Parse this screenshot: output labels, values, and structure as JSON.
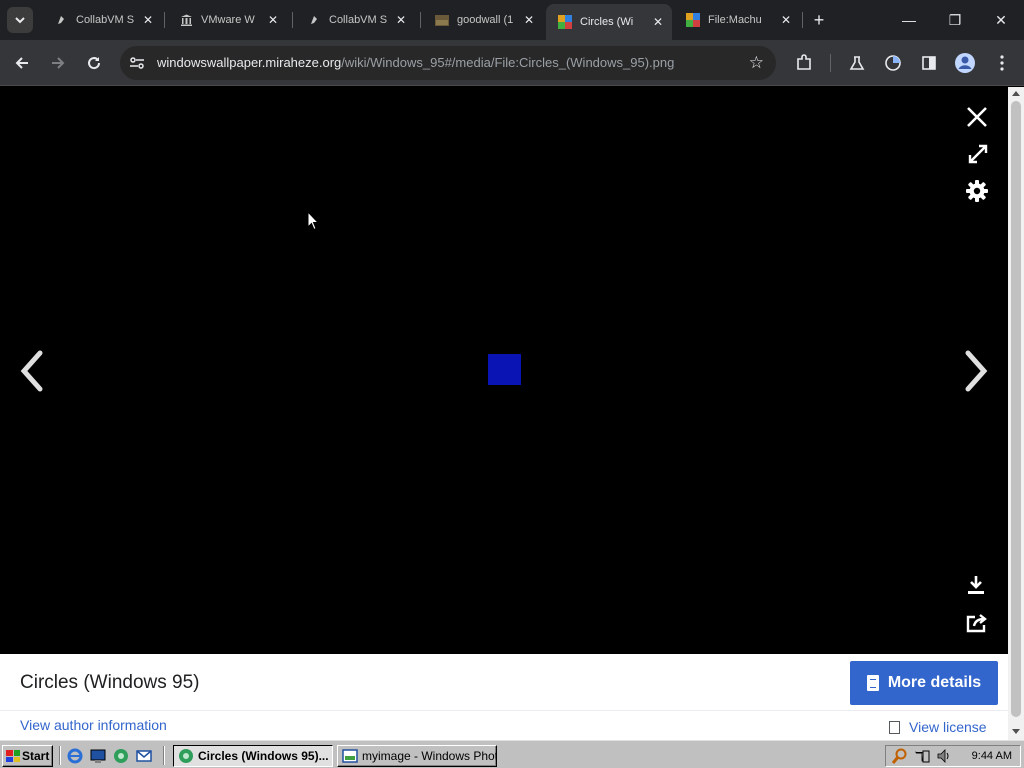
{
  "browser": {
    "tab_search_icon": "chevron-down-icon",
    "tabs": [
      {
        "title": "CollabVM S",
        "favicon": "collabvm-icon",
        "active": false
      },
      {
        "title": "VMware W",
        "favicon": "museum-icon",
        "active": false
      },
      {
        "title": "CollabVM S",
        "favicon": "collabvm-icon",
        "active": false
      },
      {
        "title": "goodwall (1",
        "favicon": "image-icon",
        "active": false
      },
      {
        "title": "Circles (Wi",
        "favicon": "wallpaper-icon",
        "active": true
      },
      {
        "title": "File:Machu",
        "favicon": "wallpaper-icon",
        "active": false
      }
    ],
    "new_tab_glyph": "+",
    "window_controls": {
      "minimize": "—",
      "restore": "❐",
      "close": "✕"
    },
    "url_host": "windowswallpaper.miraheze.org",
    "url_path": "/wiki/Windows_95#/media/File:Circles_(Windows_95).png",
    "accent": "#3366cc"
  },
  "viewer": {
    "image_color": "#0a14b4",
    "controls": [
      "close-icon",
      "fullscreen-icon",
      "gear-icon",
      "download-icon",
      "share-icon"
    ]
  },
  "info": {
    "title": "Circles (Windows 95)",
    "more_details": "More details",
    "author": "View author information",
    "license": "View license"
  },
  "taskbar": {
    "start": "Start",
    "tasks": [
      {
        "label": "Circles (Windows 95)...",
        "active": true
      },
      {
        "label": "myimage - Windows Phot...",
        "active": false
      }
    ],
    "clock": "9:44 AM"
  }
}
